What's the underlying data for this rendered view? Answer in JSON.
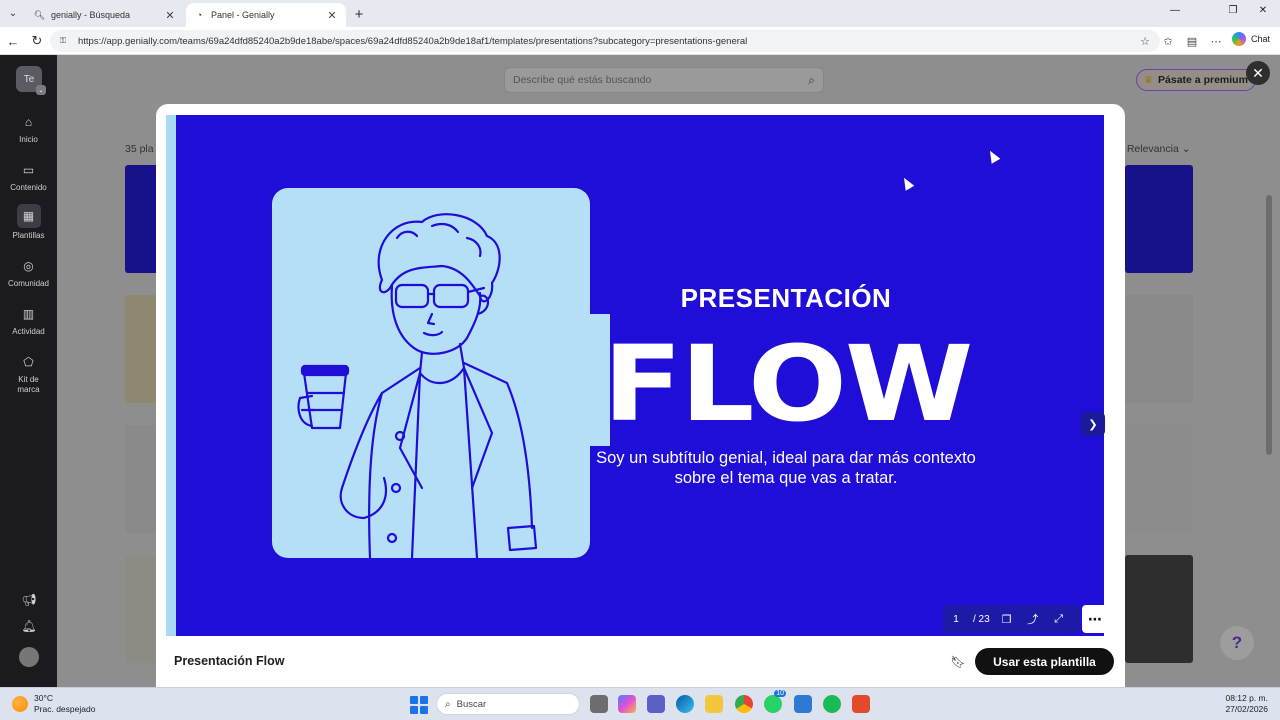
{
  "browser": {
    "tabs": [
      {
        "label": "genially - Búsqueda",
        "active": false
      },
      {
        "label": "Panel - Genially",
        "active": true
      }
    ],
    "url": "https://app.genially.com/teams/69a24dfd85240a2b9de18abe/spaces/69a24dfd85240a2b9de18af1/templates/presentations?subcategory=presentations-general",
    "chat_label": "Chat"
  },
  "sidebar": {
    "avatar_initials": "Te",
    "items": [
      {
        "label": "Inicio",
        "icon": "home-icon"
      },
      {
        "label": "Contenido",
        "icon": "folder-icon"
      },
      {
        "label": "Plantillas",
        "icon": "templates-icon",
        "selected": true
      },
      {
        "label": "Comunidad",
        "icon": "community-icon"
      },
      {
        "label": "Actividad",
        "icon": "activity-icon"
      },
      {
        "label": "Kit de marca",
        "icon": "brand-kit-icon"
      }
    ]
  },
  "page": {
    "search_placeholder": "Describe qué estás buscando",
    "premium_label": "Pásate a premium",
    "count_text": "35 pla",
    "sort_text": ": Relevancia"
  },
  "modal": {
    "template_title": "Presentación Flow",
    "use_button": "Usar esta plantilla",
    "slide": {
      "title": "PRESENTACIÓN",
      "big": "FLOW",
      "subtitle": "Soy un subtítulo genial, ideal para dar más contexto sobre el tema que vas a tratar."
    },
    "pager": {
      "current": "1",
      "total": "/ 23"
    }
  },
  "taskbar": {
    "temperature": "30°C",
    "weather": "Prac. despejado",
    "search_placeholder": "Buscar",
    "time": "08:12 p. m.",
    "date": "27/02/2026",
    "whatsapp_badge": "10"
  },
  "colors": {
    "slide_bg": "#1e0ed8",
    "illus_bg": "#b5def7",
    "primary_button": "#111111",
    "premium_border": "#6b3fb0"
  }
}
